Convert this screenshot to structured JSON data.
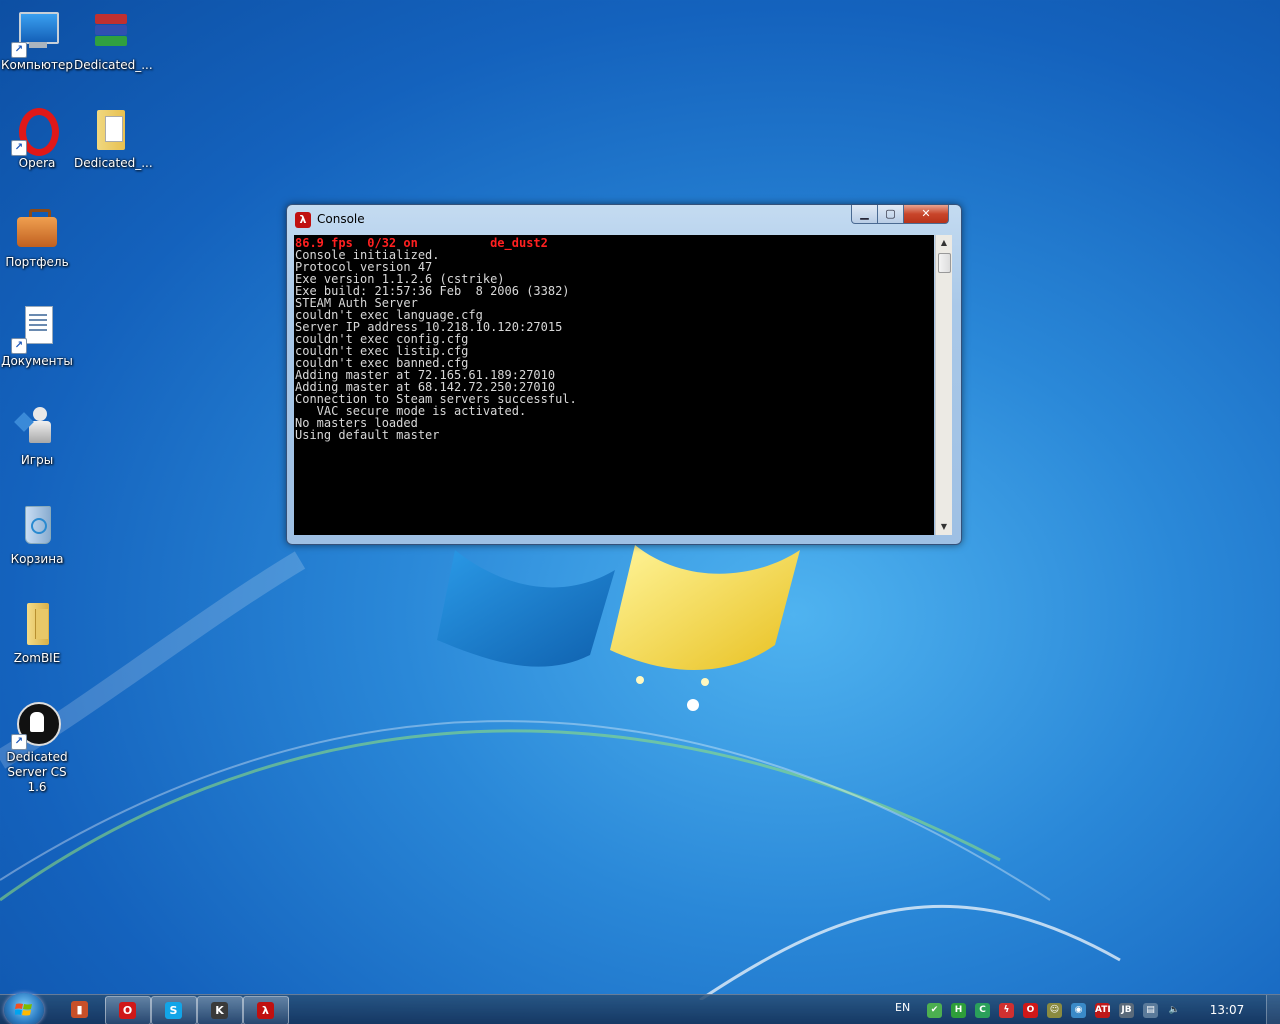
{
  "desktop": {
    "icons": [
      {
        "label": "Компьютер",
        "icon": "computer-icon"
      },
      {
        "label": "Dedicated_...",
        "icon": "winrar-archive-icon"
      },
      {
        "label": "Opera",
        "icon": "opera-icon"
      },
      {
        "label": "Dedicated_...",
        "icon": "folder-icon"
      },
      {
        "label": "Портфель",
        "icon": "briefcase-icon"
      },
      {
        "label": "Документы",
        "icon": "documents-icon"
      },
      {
        "label": "Игры",
        "icon": "games-icon"
      },
      {
        "label": "Корзина",
        "icon": "recycle-bin-icon"
      },
      {
        "label": "ZomBIE",
        "icon": "folder-icon"
      },
      {
        "label": "Dedicated Server CS 1.6",
        "icon": "dedicated-server-icon"
      }
    ]
  },
  "console_window": {
    "title": "Console",
    "controls": {
      "minimize": "▁",
      "maximize": "▢",
      "close": "✕"
    },
    "status_line": "86.9 fps  0/32 on          de_dust2",
    "lines": [
      "Console initialized.",
      "Protocol version 47",
      "Exe version 1.1.2.6 (cstrike)",
      "Exe build: 21:57:36 Feb  8 2006 (3382)",
      "STEAM Auth Server",
      "couldn't exec language.cfg",
      "Server IP address 10.218.10.120:27015",
      "couldn't exec config.cfg",
      "couldn't exec listip.cfg",
      "couldn't exec banned.cfg",
      "Adding master at 72.165.61.189:27010",
      "Adding master at 68.142.72.250:27010",
      "Connection to Steam servers successful.",
      "   VAC secure mode is activated.",
      "No masters loaded",
      "Using default master"
    ]
  },
  "taskbar": {
    "start_icon": "windows-start-icon",
    "buttons": [
      {
        "name": "taskbar-app-1",
        "icon": "app-icon",
        "glyph": "▮",
        "color": "#c8502a",
        "active": false
      },
      {
        "name": "taskbar-opera",
        "icon": "opera-icon",
        "glyph": "O",
        "color": "#d01818",
        "active": true
      },
      {
        "name": "taskbar-skype",
        "icon": "skype-icon",
        "glyph": "S",
        "color": "#12a5e8",
        "active": true
      },
      {
        "name": "taskbar-cs",
        "icon": "counter-strike-icon",
        "glyph": "K",
        "color": "#3a3a3a",
        "active": true
      },
      {
        "name": "taskbar-console",
        "icon": "half-life-icon",
        "glyph": "λ",
        "color": "#c01010",
        "active": true
      }
    ],
    "lang": "EN",
    "clock": "13:07",
    "tray_icons": [
      {
        "name": "tray-icon-1",
        "glyph": "✔",
        "color": "#4caf50"
      },
      {
        "name": "tray-icon-2",
        "glyph": "H",
        "color": "#2e9e3a"
      },
      {
        "name": "tray-icon-3",
        "glyph": "C",
        "color": "#2aa05a"
      },
      {
        "name": "tray-icon-4",
        "glyph": "ϟ",
        "color": "#d03030"
      },
      {
        "name": "tray-opera-icon",
        "glyph": "O",
        "color": "#d01818"
      },
      {
        "name": "tray-icon-6",
        "glyph": "☺",
        "color": "#8a8a40"
      },
      {
        "name": "tray-icon-7",
        "glyph": "◉",
        "color": "#3a8ac8"
      },
      {
        "name": "tray-ati-icon",
        "glyph": "ATI",
        "color": "#c01818"
      },
      {
        "name": "tray-icon-9",
        "glyph": "JB",
        "color": "#5a6a7a"
      },
      {
        "name": "tray-network-icon",
        "glyph": "▤",
        "color": "#5a7a9a"
      },
      {
        "name": "tray-volume-icon",
        "glyph": "🔈",
        "color": "transparent"
      }
    ]
  }
}
